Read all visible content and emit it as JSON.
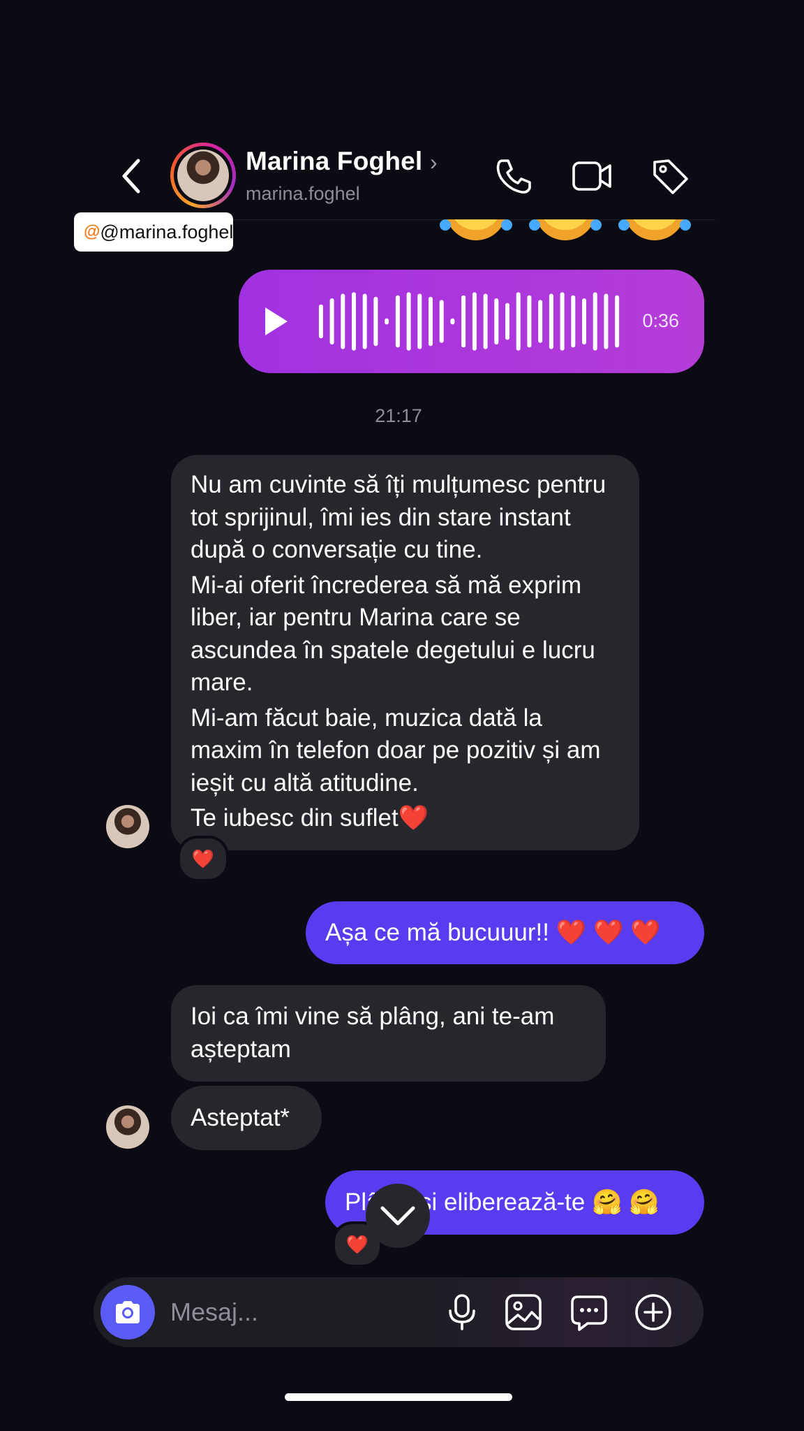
{
  "header": {
    "contact_name": "Marina Foghel",
    "chevron": "›",
    "contact_handle": "marina.foghel",
    "handle_tooltip": "@marina.foghel",
    "icons": [
      "back-arrow-icon",
      "phone-icon",
      "video-camera-icon",
      "tag-icon"
    ]
  },
  "messages": {
    "voice": {
      "duration": "0:36"
    },
    "timestamp": "21:17",
    "incoming_long": {
      "paragraphs": [
        "Nu am cuvinte să îți mulțumesc pentru tot sprijinul, îmi ies din stare instant după o conversație cu tine.",
        "Mi-ai oferit încrederea să mă exprim liber, iar pentru Marina care se ascundea în spatele degetului e lucru mare.",
        "Mi-am făcut baie, muzica dată la maxim în telefon doar pe pozitiv și am ieșit cu altă atitudine.",
        "Te iubesc din suflet❤️"
      ],
      "reaction": "❤️"
    },
    "outgoing_1": "Așa ce mă bucuuur!! ❤️ ❤️ ❤️",
    "incoming_2": "Ioi ca îmi vine să plâng, ani te-am așteptam",
    "incoming_3": "Asteptat*",
    "outgoing_2": "Plângi și eliberează-te 🤗 🤗",
    "outgoing_2_reaction": "❤️"
  },
  "composer": {
    "placeholder": "Mesaj...",
    "icons": [
      "camera-icon",
      "microphone-icon",
      "gallery-icon",
      "sticker-chat-icon",
      "plus-icon"
    ]
  },
  "colors": {
    "background": "#0b0b13",
    "incoming_bubble": "#26272c",
    "outgoing_bubble": "#5a3cf0",
    "voice_bubble": "#a131e0",
    "camera_button": "#5b5cf6"
  }
}
